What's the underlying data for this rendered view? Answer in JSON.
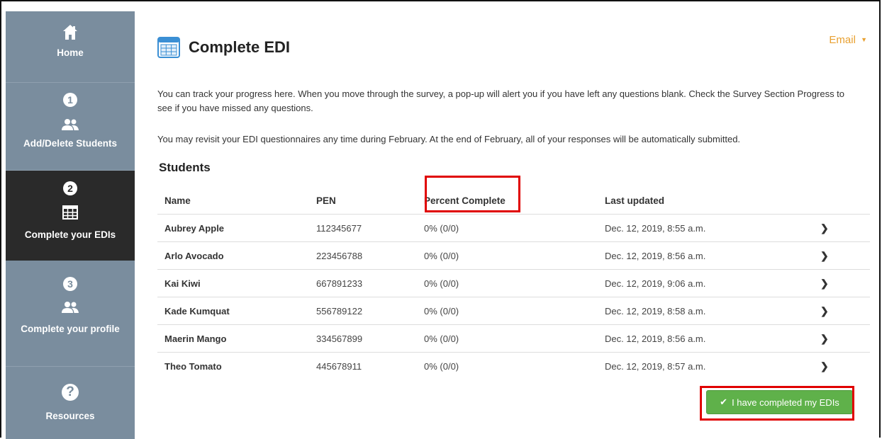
{
  "sidebar": {
    "home_label": "Home",
    "items": [
      {
        "step": "1",
        "label": "Add/Delete Students",
        "icon": "users-icon"
      },
      {
        "step": "2",
        "label": "Complete your EDIs",
        "icon": "table-icon"
      },
      {
        "step": "3",
        "label": "Complete your profile",
        "icon": "users-icon"
      }
    ],
    "help_symbol": "?",
    "resources_label": "Resources"
  },
  "header": {
    "title": "Complete EDI",
    "email_label": "Email"
  },
  "intro": {
    "paragraph1": "You can track your progress here. When you move through the survey, a pop-up will alert you if you have left any questions blank. Check the Survey Section Progress to see if you have missed any questions.",
    "paragraph2": "You may revisit your EDI questionnaires any time during February. At the end of February, all of your responses will be automatically submitted."
  },
  "students_heading": "Students",
  "table": {
    "columns": [
      "Name",
      "PEN",
      "Percent Complete",
      "Last updated"
    ],
    "rows": [
      {
        "name": "Aubrey Apple",
        "pen": "112345677",
        "percent": "0% (0/0)",
        "updated": "Dec. 12, 2019, 8:55 a.m."
      },
      {
        "name": "Arlo Avocado",
        "pen": "223456788",
        "percent": "0% (0/0)",
        "updated": "Dec. 12, 2019, 8:56 a.m."
      },
      {
        "name": "Kai Kiwi",
        "pen": "667891233",
        "percent": "0% (0/0)",
        "updated": "Dec. 12, 2019, 9:06 a.m."
      },
      {
        "name": "Kade Kumquat",
        "pen": "556789122",
        "percent": "0% (0/0)",
        "updated": "Dec. 12, 2019, 8:58 a.m."
      },
      {
        "name": "Maerin Mango",
        "pen": "334567899",
        "percent": "0% (0/0)",
        "updated": "Dec. 12, 2019, 8:56 a.m."
      },
      {
        "name": "Theo Tomato",
        "pen": "445678911",
        "percent": "0% (0/0)",
        "updated": "Dec. 12, 2019, 8:57 a.m."
      }
    ]
  },
  "complete_button_label": "I have completed my EDIs",
  "colors": {
    "sidebar_bg": "#7a8d9e",
    "sidebar_active_bg": "#2a2a2a",
    "accent_orange": "#e8a030",
    "button_green": "#5fb14a",
    "highlight_red": "#e00000",
    "title_icon_blue": "#3b8fd4"
  }
}
